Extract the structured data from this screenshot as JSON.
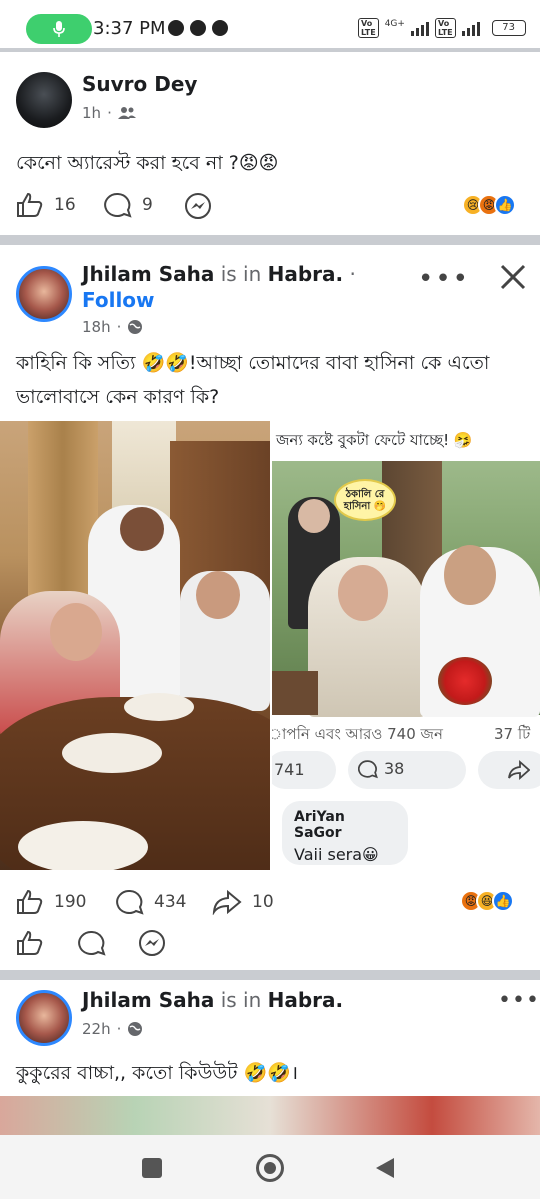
{
  "status_bar": {
    "time": "3:37 PM",
    "network": "4G+",
    "battery": "73"
  },
  "post1": {
    "author": "Suvro Dey",
    "time": "1h",
    "text": "কেনো অ্যারেস্ট করা হবে না ?😡😡",
    "likes": "16",
    "comments": "9",
    "reaction_icons": [
      "sad-reaction-icon",
      "angry-reaction-icon",
      "like-reaction-icon"
    ]
  },
  "post2": {
    "author": "Jhilam Saha",
    "is_in": "is in",
    "location": "Habra.",
    "follow_label": "Follow",
    "time": "18h",
    "text": "কাহিনি কি সত্যি 🤣🤣!আচ্ছা তোমাদের বাবা হাসিনা কে এতো ভালোবাসে কেন কারণ কি?",
    "right_caption": "জন্য কষ্টে বুকটা ফেটে যাচ্ছে! 🤧",
    "bubble_text": "ঠকালি রে হাসিনা 🤭",
    "embedded_reactions_text": "াপনি এবং আরও 740 জন",
    "embedded_comments_count": "37 টি",
    "embedded_likes": "741",
    "embedded_comments": "38",
    "embedded_commenter": "AriYan SaGor",
    "embedded_comment": "Vaii sera😀",
    "likes": "190",
    "comments": "434",
    "shares": "10",
    "reaction_icons": [
      "angry-reaction-icon",
      "haha-reaction-icon",
      "like-reaction-icon"
    ]
  },
  "post3": {
    "author": "Jhilam Saha",
    "is_in": "is in",
    "location": "Habra.",
    "time": "22h",
    "text": "কুকুরের বাচ্চা,, কতো কিউউট 🤣🤣।"
  }
}
